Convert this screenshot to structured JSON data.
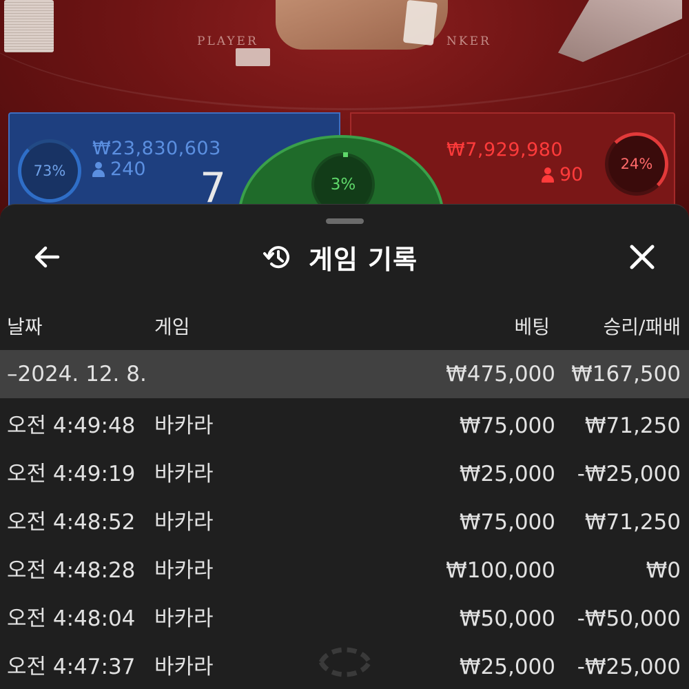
{
  "scene": {
    "player_label": "PLAYER",
    "banker_label": "NKER"
  },
  "stats": {
    "player": {
      "percent": "73%",
      "amount": "₩23,830,603",
      "count": "240",
      "score": "7"
    },
    "banker": {
      "percent": "24%",
      "amount": "₩7,929,980",
      "count": "90"
    },
    "tie": {
      "percent": "3%"
    },
    "colors": {
      "player": "#5b8fe0",
      "banker": "#ff3b3b",
      "tie": "#5fd86a"
    }
  },
  "sheet": {
    "title": "게임 기록",
    "icons": {
      "back": "arrow-left-icon",
      "history": "history-icon",
      "close": "close-icon"
    },
    "columns": {
      "date": "날짜",
      "game": "게임",
      "bet": "베팅",
      "win_loss": "승리/패배"
    },
    "day_summary": {
      "date": "–2024. 12. 8.",
      "bet": "₩475,000",
      "win_loss": "₩167,500"
    },
    "rows": [
      {
        "time": "오전 4:49:48",
        "game": "바카라",
        "bet": "₩75,000",
        "win_loss": "₩71,250"
      },
      {
        "time": "오전 4:49:19",
        "game": "바카라",
        "bet": "₩25,000",
        "win_loss": "-₩25,000"
      },
      {
        "time": "오전 4:48:52",
        "game": "바카라",
        "bet": "₩75,000",
        "win_loss": "₩71,250"
      },
      {
        "time": "오전 4:48:28",
        "game": "바카라",
        "bet": "₩100,000",
        "win_loss": "₩0"
      },
      {
        "time": "오전 4:48:04",
        "game": "바카라",
        "bet": "₩50,000",
        "win_loss": "-₩50,000"
      },
      {
        "time": "오전 4:47:37",
        "game": "바카라",
        "bet": "₩25,000",
        "win_loss": "-₩25,000"
      }
    ]
  }
}
